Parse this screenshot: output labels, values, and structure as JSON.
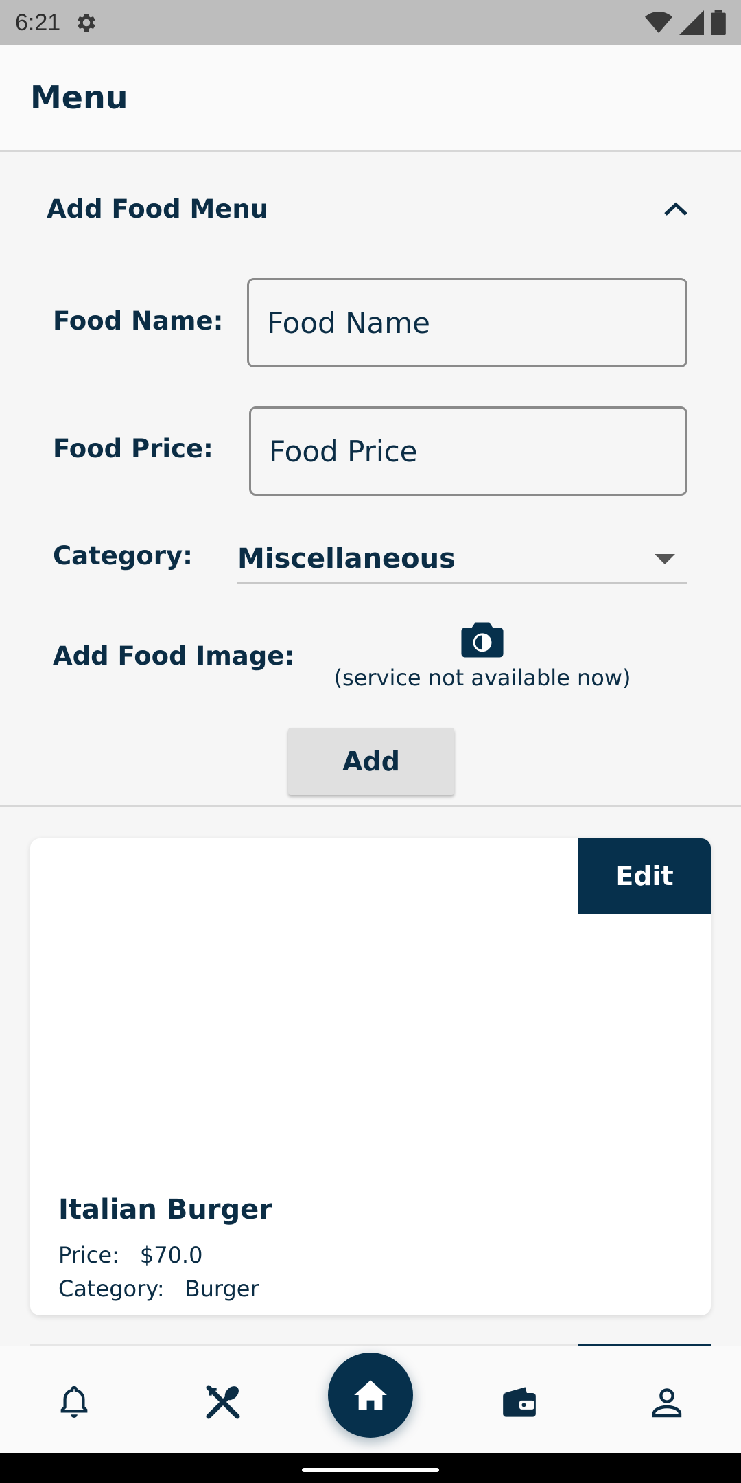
{
  "status_bar": {
    "time": "6:21"
  },
  "app_bar": {
    "title": "Menu"
  },
  "add_section": {
    "title": "Add Food Menu",
    "food_name_label": "Food Name:",
    "food_name_placeholder": "Food Name",
    "food_price_label": "Food Price:",
    "food_price_placeholder": "Food Price",
    "category_label": "Category:",
    "category_value": "Miscellaneous",
    "image_label": "Add Food Image:",
    "image_note": "(service not available now)",
    "add_label": "Add"
  },
  "food_items": [
    {
      "name": "Italian Burger",
      "price_label": "Price:",
      "price": "$70.0",
      "category_label": "Category:",
      "category": "Burger",
      "edit_label": "Edit"
    }
  ],
  "bottom_nav": {
    "items": [
      "bell-icon",
      "restaurant-icon",
      "home-icon",
      "wallet-icon",
      "person-icon"
    ]
  },
  "colors": {
    "primary": "#06304c",
    "background": "#f6f6f6",
    "button_gray": "#e0e0e0"
  }
}
